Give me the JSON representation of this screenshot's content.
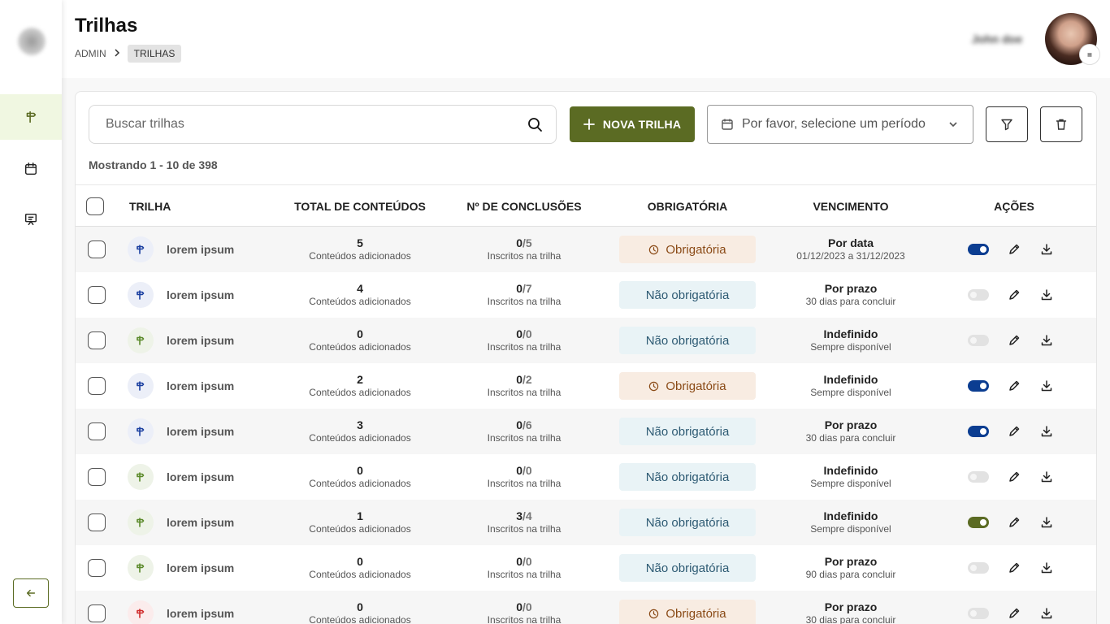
{
  "sidebar": {
    "items": [
      {
        "name": "sidebar-item-trilhas",
        "icon": "signpost-icon",
        "active": true
      },
      {
        "name": "sidebar-item-calendar",
        "icon": "calendar-icon",
        "active": false
      },
      {
        "name": "sidebar-item-presentation",
        "icon": "presentation-icon",
        "active": false
      }
    ],
    "collapse_icon": "arrow-left-icon"
  },
  "header": {
    "title": "Trilhas",
    "breadcrumb": [
      "ADMIN",
      "TRILHAS"
    ],
    "user_name": "John doe"
  },
  "toolbar": {
    "search_placeholder": "Buscar trilhas",
    "new_button_label": "NOVA TRILHA",
    "date_placeholder": "Por favor, selecione um período"
  },
  "showing_text": "Mostrando 1 - 10 de 398",
  "table": {
    "headers": [
      "TRILHA",
      "TOTAL DE CONTEÚDOS",
      "Nº DE CONCLUSÕES",
      "OBRIGATÓRIA",
      "VENCIMENTO",
      "AÇÕES"
    ],
    "contents_caption": "Conteúdos adicionados",
    "completions_caption": "Inscritos na trilha",
    "rows": [
      {
        "name": "lorem ipsum",
        "color": "blue",
        "contents": "5",
        "done": "0",
        "total": "/5",
        "required": "Obrigatória",
        "due_title": "Por data",
        "due_sub": "01/12/2023 a 31/12/2023",
        "toggle": "on-blue"
      },
      {
        "name": "lorem ipsum",
        "color": "blue",
        "contents": "4",
        "done": "0",
        "total": "/7",
        "required": "Não obrigatória",
        "due_title": "Por prazo",
        "due_sub": "30 dias para concluir",
        "toggle": "off"
      },
      {
        "name": "lorem ipsum",
        "color": "green",
        "contents": "0",
        "done": "0",
        "total": "/0",
        "required": "Não obrigatória",
        "due_title": "Indefinido",
        "due_sub": "Sempre disponível",
        "toggle": "off"
      },
      {
        "name": "lorem ipsum",
        "color": "blue",
        "contents": "2",
        "done": "0",
        "total": "/2",
        "required": "Obrigatória",
        "due_title": "Indefinido",
        "due_sub": "Sempre disponível",
        "toggle": "on-blue"
      },
      {
        "name": "lorem ipsum",
        "color": "blue",
        "contents": "3",
        "done": "0",
        "total": "/6",
        "required": "Não obrigatória",
        "due_title": "Por prazo",
        "due_sub": "30 dias para concluir",
        "toggle": "on-blue"
      },
      {
        "name": "lorem ipsum",
        "color": "green",
        "contents": "0",
        "done": "0",
        "total": "/0",
        "required": "Não obrigatória",
        "due_title": "Indefinido",
        "due_sub": "Sempre disponível",
        "toggle": "off"
      },
      {
        "name": "lorem ipsum",
        "color": "green",
        "contents": "1",
        "done": "3",
        "total": "/4",
        "required": "Não obrigatória",
        "due_title": "Indefinido",
        "due_sub": "Sempre disponível",
        "toggle": "on-green"
      },
      {
        "name": "lorem ipsum",
        "color": "green",
        "contents": "0",
        "done": "0",
        "total": "/0",
        "required": "Não obrigatória",
        "due_title": "Por prazo",
        "due_sub": "90 dias para concluir",
        "toggle": "off"
      },
      {
        "name": "lorem ipsum",
        "color": "red",
        "contents": "0",
        "done": "0",
        "total": "/0",
        "required": "Obrigatória",
        "due_title": "Por prazo",
        "due_sub": "30 dias para concluir",
        "toggle": "off"
      }
    ]
  },
  "colors": {
    "primary": "#5b6b23",
    "toggle_blue": "#0b3d91",
    "toggle_green": "#5b6b23",
    "icon_blue": "#1a3fa0",
    "icon_green": "#5b8a2a",
    "icon_red": "#d02b2b"
  }
}
